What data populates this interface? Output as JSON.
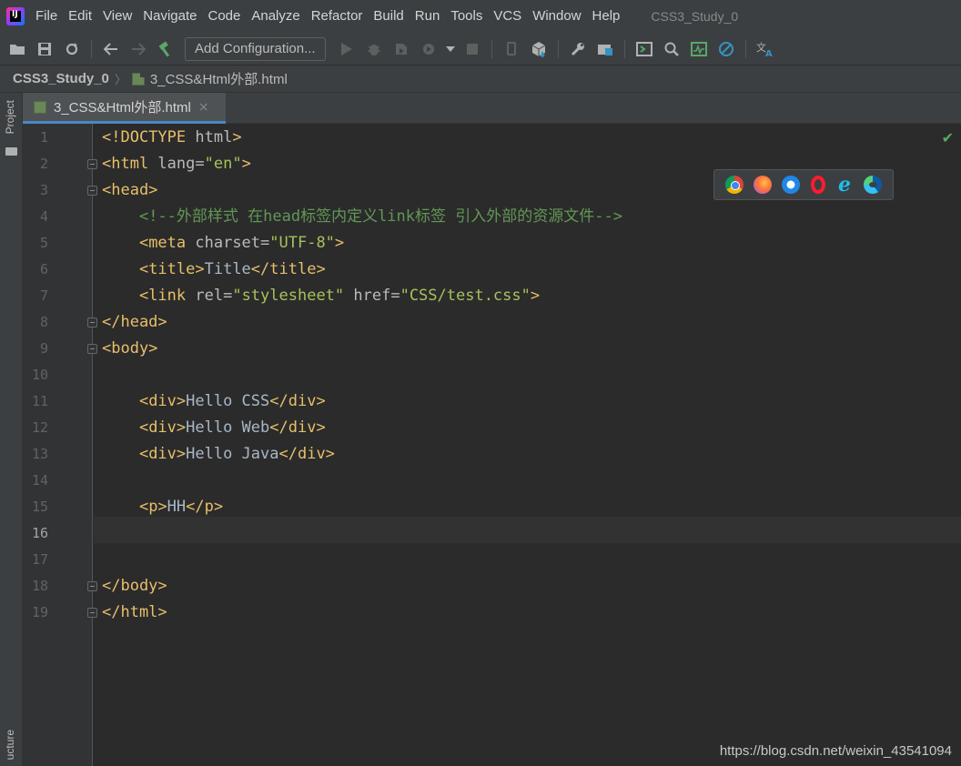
{
  "app": {
    "logo_text": "IJ",
    "menu": [
      "File",
      "Edit",
      "View",
      "Navigate",
      "Code",
      "Analyze",
      "Refactor",
      "Build",
      "Run",
      "Tools",
      "VCS",
      "Window",
      "Help"
    ],
    "window_title": "CSS3_Study_0"
  },
  "toolbar": {
    "run_config_label": "Add Configuration..."
  },
  "breadcrumb": {
    "project": "CSS3_Study_0",
    "file": "3_CSS&Html外部.html"
  },
  "side_panels": {
    "project_label": "Project",
    "structure_label": "ucture"
  },
  "editor": {
    "tab_label": "3_CSS&Html外部.html",
    "current_line": 16,
    "line_numbers": [
      "1",
      "2",
      "3",
      "4",
      "5",
      "6",
      "7",
      "8",
      "9",
      "10",
      "11",
      "12",
      "13",
      "14",
      "15",
      "16",
      "17",
      "18",
      "19"
    ],
    "lines": [
      {
        "indent": "",
        "parts": [
          {
            "c": "t-doc",
            "t": "<!DOCTYPE "
          },
          {
            "c": "t-attr",
            "t": "html"
          },
          {
            "c": "t-doc",
            "t": ">"
          }
        ]
      },
      {
        "indent": "",
        "parts": [
          {
            "c": "t-tag",
            "t": "<html "
          },
          {
            "c": "t-attr",
            "t": "lang="
          },
          {
            "c": "t-val",
            "t": "\"en\""
          },
          {
            "c": "t-tag",
            "t": ">"
          }
        ]
      },
      {
        "indent": "",
        "parts": [
          {
            "c": "t-tag",
            "t": "<head>"
          }
        ]
      },
      {
        "indent": "    ",
        "parts": [
          {
            "c": "t-comment",
            "t": "<!--外部样式 在head标签内定义link标签 引入外部的资源文件-->"
          }
        ]
      },
      {
        "indent": "    ",
        "parts": [
          {
            "c": "t-tag",
            "t": "<meta "
          },
          {
            "c": "t-attr",
            "t": "charset="
          },
          {
            "c": "t-val",
            "t": "\"UTF-8\""
          },
          {
            "c": "t-tag",
            "t": ">"
          }
        ]
      },
      {
        "indent": "    ",
        "parts": [
          {
            "c": "t-tag",
            "t": "<title>"
          },
          {
            "c": "t-text",
            "t": "Title"
          },
          {
            "c": "t-tag",
            "t": "</title>"
          }
        ]
      },
      {
        "indent": "    ",
        "parts": [
          {
            "c": "t-tag",
            "t": "<link "
          },
          {
            "c": "t-attr",
            "t": "rel="
          },
          {
            "c": "t-val",
            "t": "\"stylesheet\" "
          },
          {
            "c": "t-attr",
            "t": "href="
          },
          {
            "c": "t-val",
            "t": "\"CSS/test.css\""
          },
          {
            "c": "t-tag",
            "t": ">"
          }
        ]
      },
      {
        "indent": "",
        "parts": [
          {
            "c": "t-tag",
            "t": "</head>"
          }
        ]
      },
      {
        "indent": "",
        "parts": [
          {
            "c": "t-tag",
            "t": "<body>"
          }
        ]
      },
      {
        "indent": "",
        "parts": []
      },
      {
        "indent": "    ",
        "parts": [
          {
            "c": "t-tag",
            "t": "<div>"
          },
          {
            "c": "t-text",
            "t": "Hello CSS"
          },
          {
            "c": "t-tag",
            "t": "</div>"
          }
        ]
      },
      {
        "indent": "    ",
        "parts": [
          {
            "c": "t-tag",
            "t": "<div>"
          },
          {
            "c": "t-text",
            "t": "Hello Web"
          },
          {
            "c": "t-tag",
            "t": "</div>"
          }
        ]
      },
      {
        "indent": "    ",
        "parts": [
          {
            "c": "t-tag",
            "t": "<div>"
          },
          {
            "c": "t-text",
            "t": "Hello Java"
          },
          {
            "c": "t-tag",
            "t": "</div>"
          }
        ]
      },
      {
        "indent": "",
        "parts": []
      },
      {
        "indent": "    ",
        "parts": [
          {
            "c": "t-tag",
            "t": "<p>"
          },
          {
            "c": "t-text",
            "t": "HH"
          },
          {
            "c": "t-tag",
            "t": "</p>"
          }
        ]
      },
      {
        "indent": "",
        "parts": []
      },
      {
        "indent": "",
        "parts": []
      },
      {
        "indent": "",
        "parts": [
          {
            "c": "t-tag",
            "t": "</body>"
          }
        ]
      },
      {
        "indent": "",
        "parts": [
          {
            "c": "t-tag",
            "t": "</html>"
          }
        ]
      }
    ]
  },
  "browsers": [
    "chrome-icon",
    "firefox-icon",
    "safari-icon",
    "opera-icon",
    "ie-icon",
    "edge-icon"
  ],
  "watermark": "https://blog.csdn.net/weixin_43541094"
}
